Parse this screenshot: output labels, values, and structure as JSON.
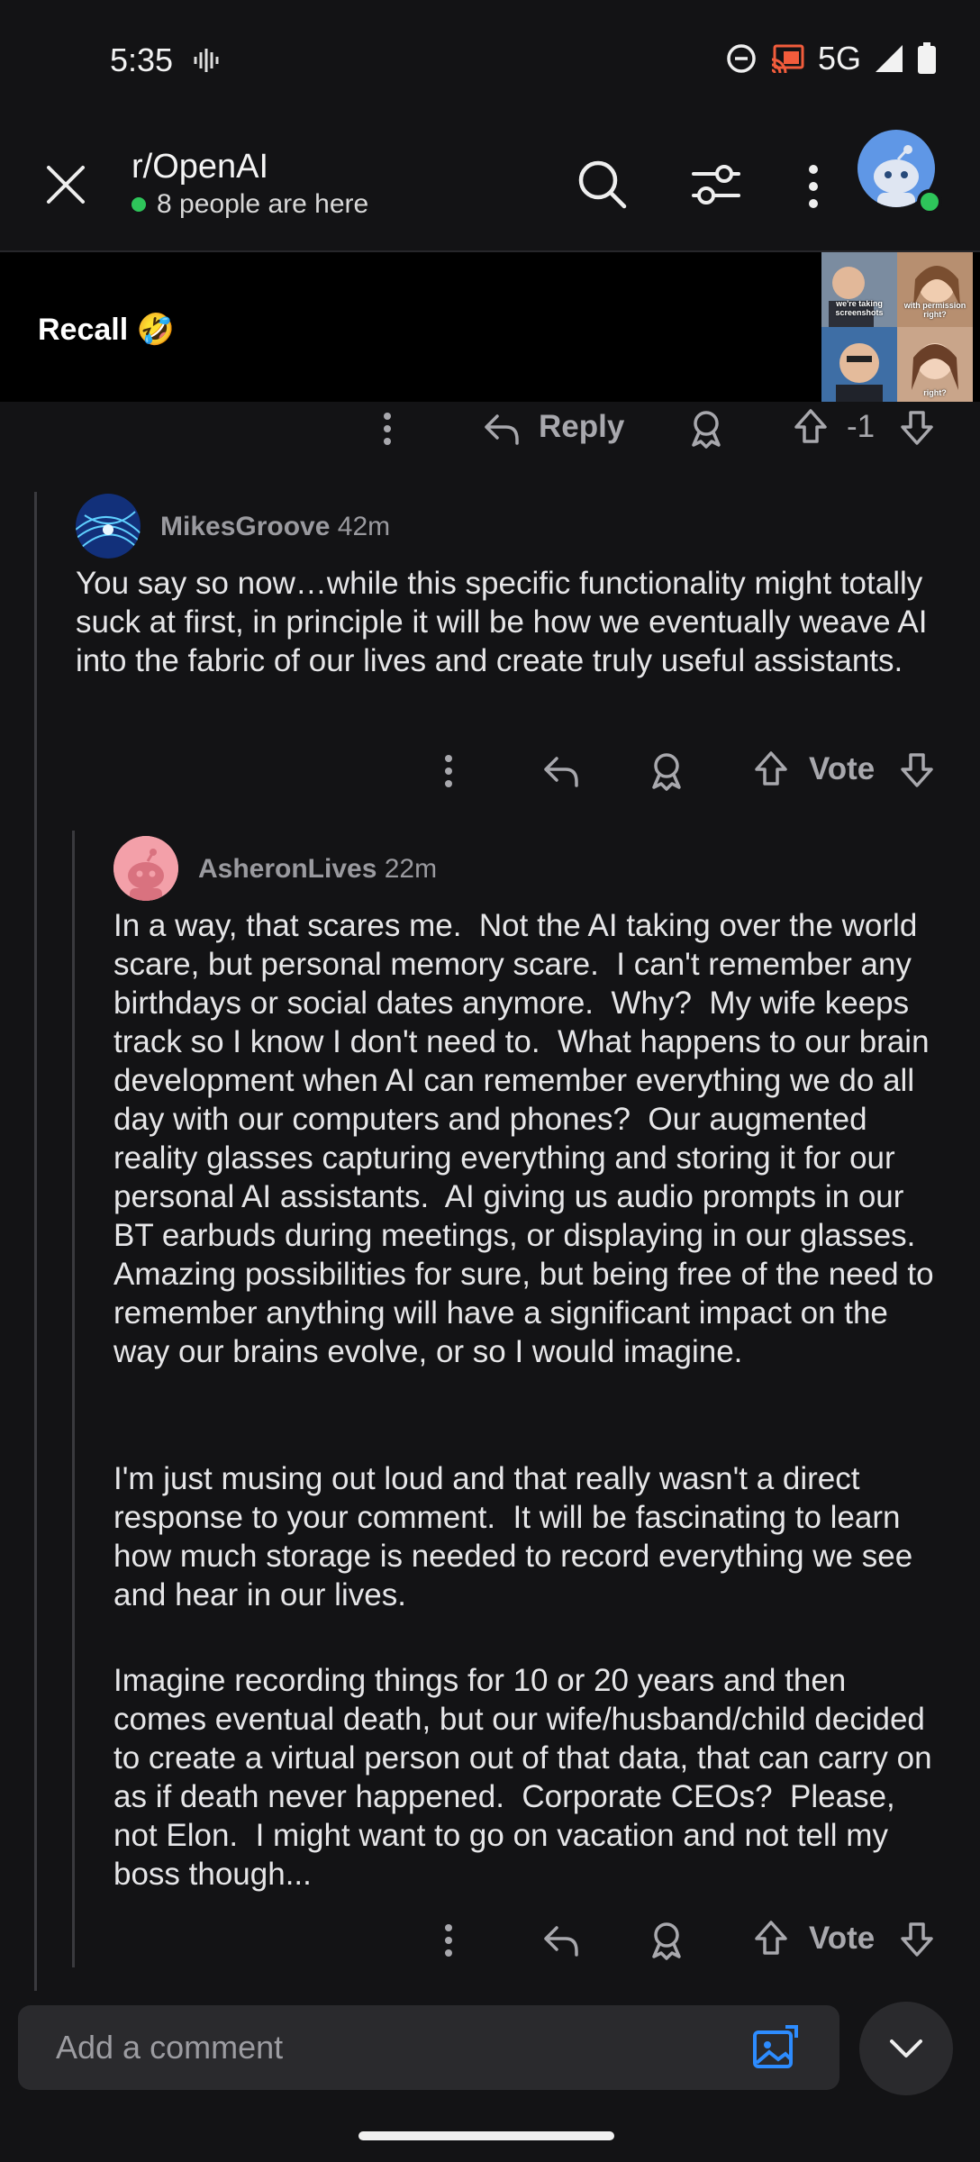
{
  "status_bar": {
    "time": "5:35",
    "network": "5G",
    "icons": [
      "vibrate-icon",
      "do-not-disturb-icon",
      "cast-icon",
      "signal-icon",
      "battery-icon"
    ]
  },
  "header": {
    "title": "r/OpenAI",
    "presence": "8 people are here",
    "icons": [
      "close-icon",
      "search-icon",
      "filter-icon",
      "more-icon"
    ]
  },
  "preview": {
    "caption": "Recall 🤣",
    "meme_text": [
      "we're taking screenshots",
      "with permission right?",
      "right?"
    ]
  },
  "top_actions": {
    "reply_label": "Reply",
    "score": "-1"
  },
  "comments": [
    {
      "username": "MikesGroove",
      "age": "42m",
      "body": "You say so now…while this specific functionality might totally suck at first, in principle it will be how we eventually weave AI into the fabric of our lives and create truly useful assistants.",
      "vote_label": "Vote"
    },
    {
      "username": "AsheronLives",
      "age": "22m",
      "body_p1": "In a way, that scares me.  Not the AI taking over the world scare, but personal memory scare.  I can't remember any birthdays or social dates anymore.  Why?  My wife keeps track so I know I don't need to.  What happens to our brain development when AI can remember everything we do all day with our computers and phones?  Our augmented reality glasses capturing everything and storing it for our personal AI assistants.  AI giving us audio prompts in our BT earbuds during meetings, or displaying in our glasses.  Amazing possibilities for sure, but being free of the need to remember anything will have a significant impact on the way our brains evolve, or so I would imagine.",
      "body_p2": "I'm just musing out loud and that really wasn't a direct response to your comment.  It will be fascinating to learn how much storage is needed to record everything we see and hear in our lives.",
      "body_p3": "Imagine recording things for 10 or 20 years and then comes eventual death, but our wife/husband/child decided to create a virtual person out of that data, that can carry on as if death never happened.  Corporate CEOs?  Please, not Elon.  I might want to go on vacation and not tell my boss though...",
      "vote_label": "Vote"
    }
  ],
  "composer": {
    "placeholder": "Add a comment"
  },
  "colors": {
    "background": "#131315",
    "online": "#2ec55a",
    "accent_blue": "#2d8cff",
    "avatar_pink": "#f3a0a9"
  }
}
